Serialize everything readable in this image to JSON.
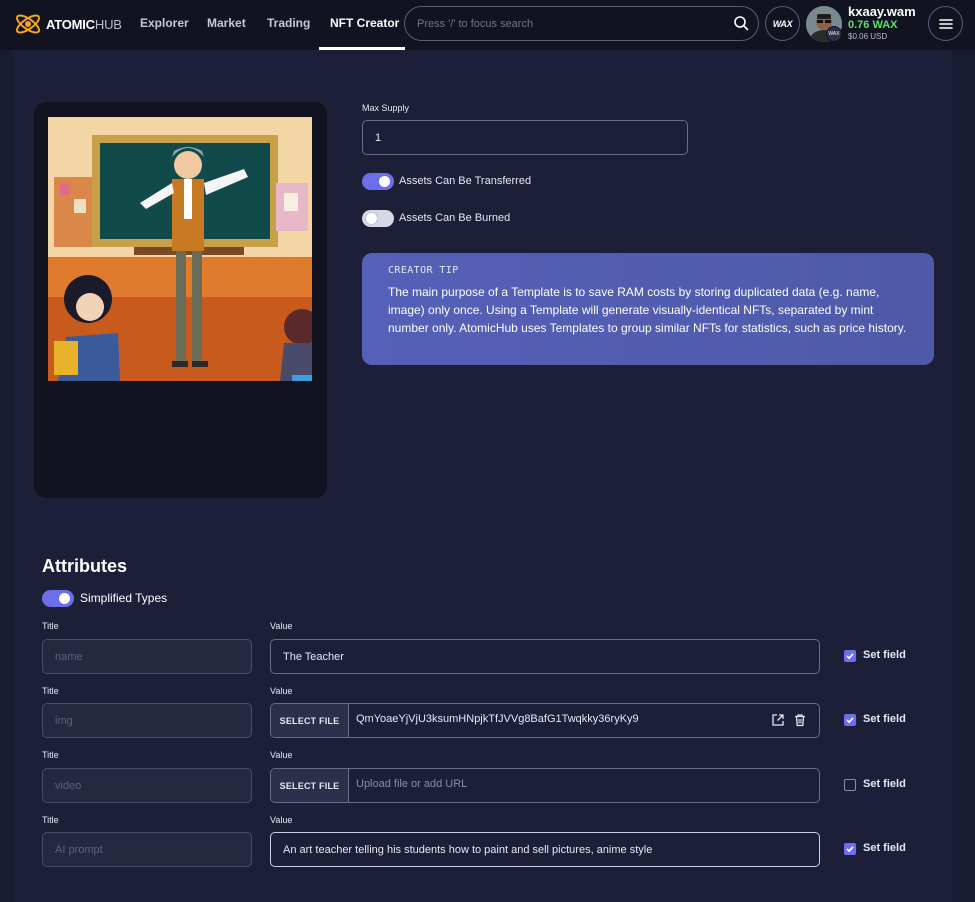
{
  "nav": {
    "logo_bold": "ATOMIC",
    "logo_light": "HUB",
    "links": [
      "Explorer",
      "Market",
      "Trading",
      "NFT Creator"
    ],
    "active": "NFT Creator",
    "search_placeholder": "Press '/' to focus search",
    "wax_label": "WAX",
    "user": {
      "name": "kxaay.wam",
      "balance": "0.76 WAX",
      "usd": "$0.06 USD",
      "badge": "WAX"
    }
  },
  "form": {
    "max_supply_label": "Max Supply",
    "max_supply_value": "1",
    "transferable": {
      "label": "Assets Can Be Transferred",
      "on": true
    },
    "burnable": {
      "label": "Assets Can Be Burned",
      "on": false
    }
  },
  "tip": {
    "title": "CREATOR TIP",
    "body": "The main purpose of a Template is to save RAM costs by storing duplicated data (e.g. name, image) only once. Using a Template will generate visually-identical NFTs, separated by mint number only. AtomicHub uses Templates to group similar NFTs for statistics, such as price history."
  },
  "attributes": {
    "heading": "Attributes",
    "simplified_label": "Simplified Types",
    "simplified_on": true,
    "title_label": "Title",
    "value_label": "Value",
    "select_file_label": "SELECT FILE",
    "set_field_label": "Set field",
    "rows": [
      {
        "title_placeholder": "name",
        "kind": "text",
        "value": "The Teacher",
        "set": true
      },
      {
        "title_placeholder": "img",
        "kind": "file",
        "value": "QmYoaeYjVjU3ksumHNpjkTfJVVg8BafG1Twqkky36ryKy9",
        "set": true
      },
      {
        "title_placeholder": "video",
        "kind": "file",
        "value": "",
        "placeholder": "Upload file or add URL",
        "set": false
      },
      {
        "title_placeholder": "AI prompt",
        "kind": "text",
        "value": "An art teacher telling his students how to paint and sell pictures, anime style",
        "set": true
      }
    ]
  },
  "colors": {
    "accent": "#6c6eea",
    "balance_green": "#5ee06c",
    "tip_bg": "#5560b8",
    "bg": "#1a1c33"
  }
}
